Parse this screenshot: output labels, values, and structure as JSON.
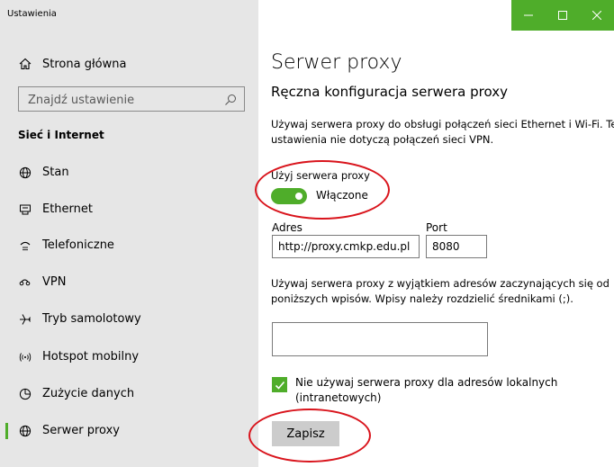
{
  "window": {
    "title": "Ustawienia"
  },
  "sidebar": {
    "home_label": "Strona główna",
    "search_placeholder": "Znajdź ustawienie",
    "section_header": "Sieć i Internet",
    "items": [
      {
        "label": "Stan",
        "icon": "globe-icon"
      },
      {
        "label": "Ethernet",
        "icon": "ethernet-icon"
      },
      {
        "label": "Telefoniczne",
        "icon": "dialup-icon"
      },
      {
        "label": "VPN",
        "icon": "vpn-icon"
      },
      {
        "label": "Tryb samolotowy",
        "icon": "airplane-icon"
      },
      {
        "label": "Hotspot mobilny",
        "icon": "hotspot-icon"
      },
      {
        "label": "Zużycie danych",
        "icon": "data-usage-icon"
      },
      {
        "label": "Serwer proxy",
        "icon": "globe-icon",
        "active": true
      }
    ]
  },
  "main": {
    "title": "Serwer proxy",
    "subtitle": "Ręczna konfiguracja serwera proxy",
    "description": "Używaj serwera proxy do obsługi połączeń sieci Ethernet i Wi-Fi. Te ustawienia nie dotyczą połączeń sieci VPN.",
    "use_proxy_label": "Użyj serwera proxy",
    "toggle_state": "Włączone",
    "toggle_on": true,
    "address_label": "Adres",
    "address_value": "http://proxy.cmkp.edu.pl",
    "port_label": "Port",
    "port_value": "8080",
    "exceptions_description": "Używaj serwera proxy z wyjątkiem adresów zaczynających się od poniższych wpisów. Wpisy należy rozdzielić średnikami (;).",
    "exceptions_value": "",
    "local_checkbox_checked": true,
    "local_checkbox_label": "Nie używaj serwera proxy dla adresów lokalnych (intranetowych)",
    "save_label": "Zapisz"
  },
  "colors": {
    "accent": "#4fad2a",
    "sidebar_bg": "#e6e6e6",
    "annotation": "#d9141c"
  }
}
